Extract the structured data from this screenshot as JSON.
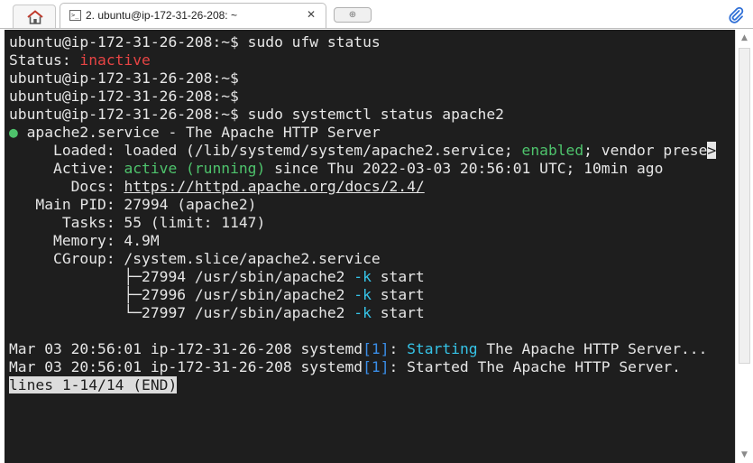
{
  "tabbar": {
    "home_icon": "home-icon",
    "tab_title": "2. ubuntu@ip-172-31-26-208: ~",
    "terminal_icon_glyph": ">_",
    "close_glyph": "✕",
    "new_tab_glyph": "⊕",
    "attach_icon": "paperclip-icon"
  },
  "terminal": {
    "prompt": "ubuntu@ip-172-31-26-208:~$",
    "cmd_ufw": " sudo ufw status",
    "status_label": "Status: ",
    "status_value": "inactive",
    "cmd_systemctl": " sudo systemctl status apache2",
    "service_dot": "●",
    "service_line": " apache2.service - The Apache HTTP Server",
    "loaded_label": "     Loaded: ",
    "loaded_pre": "loaded (/lib/systemd/system/apache2.service; ",
    "loaded_enabled": "enabled",
    "loaded_post": "; vendor prese",
    "truncation_marker": ">",
    "active_label": "     Active: ",
    "active_value": "active (running)",
    "active_since": " since Thu 2022-03-03 20:56:01 UTC; 10min ago",
    "docs_label": "       Docs: ",
    "docs_url": "https://httpd.apache.org/docs/2.4/",
    "mainpid_line": "   Main PID: 27994 (apache2)",
    "tasks_line": "      Tasks: 55 (limit: 1147)",
    "memory_line": "     Memory: 4.9M",
    "cgroup_line": "     CGroup: /system.slice/apache2.service",
    "proc1_pre": "             ├─27994 /usr/sbin/apache2 ",
    "proc2_pre": "             ├─27996 /usr/sbin/apache2 ",
    "proc3_pre": "             └─27997 /usr/sbin/apache2 ",
    "proc_flag": "-k",
    "proc_post": " start",
    "log_prefix": "Mar 03 20:56:01 ip-172-31-26-208 systemd",
    "log_pid": "[1]",
    "log1_colon": ": ",
    "log1_starting": "Starting",
    "log1_rest": " The Apache HTTP Server...",
    "log2_rest": ": Started The Apache HTTP Server.",
    "pager_status": "lines 1-14/14 (END)"
  },
  "scrollbar": {
    "up_glyph": "▲",
    "down_glyph": "▼"
  },
  "colors": {
    "terminal_bg": "#1e1e1e",
    "text": "#e6e6e6",
    "red": "#e64444",
    "green": "#4ec36c",
    "cyan": "#36c4e8",
    "blue": "#3a8ee8"
  }
}
